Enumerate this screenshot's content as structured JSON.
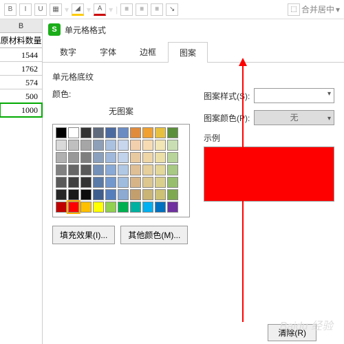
{
  "toolbar": {
    "merge_label": "合并居中"
  },
  "sheet": {
    "col": "B",
    "header": "原材料数量",
    "rows": [
      "1544",
      "1762",
      "574",
      "500",
      "1000"
    ]
  },
  "dialog": {
    "title": "单元格格式",
    "tabs": {
      "num": "数字",
      "font": "字体",
      "border": "边框",
      "pattern": "图案"
    },
    "shading": "单元格底纹",
    "color_label": "颜色:",
    "no_pattern": "无图案",
    "pattern_style": "图案样式(S):",
    "pattern_color": "图案颜色(P):",
    "none": "无",
    "sample": "示例",
    "fill_effects": "填充效果(I)...",
    "other_colors": "其他颜色(M)...",
    "clear": "清除(R)"
  },
  "palette": {
    "row1": [
      "#000000",
      "#ffffff",
      "#333333",
      "#5f6a7d",
      "#4b6aa0",
      "#6b8bc3",
      "#e08b3c",
      "#f0a030",
      "#e8c040",
      "#5b8f3a"
    ],
    "row2": [
      "#d9d9d9",
      "#bfbfbf",
      "#a6a6a6",
      "#8ea0b8",
      "#aac1e0",
      "#c7d6ec",
      "#f2d0ad",
      "#f7dcb3",
      "#f3e6b6",
      "#c9dfb3"
    ],
    "row3": [
      "#b0b0b0",
      "#999999",
      "#7f7f7f",
      "#8aa0bd",
      "#9fb8dc",
      "#c1d3ea",
      "#e8caa0",
      "#eed6a6",
      "#ecdfa8",
      "#b8d49a"
    ],
    "row4": [
      "#808080",
      "#666666",
      "#595959",
      "#7290b8",
      "#89a9d6",
      "#b0c8e4",
      "#dfbf95",
      "#e6cf9a",
      "#e3d79a",
      "#a7c983"
    ],
    "row5": [
      "#595959",
      "#404040",
      "#333333",
      "#5a7ba8",
      "#7298ce",
      "#9fbcde",
      "#d6b488",
      "#ddc78e",
      "#dbcf8d",
      "#96be6c"
    ],
    "row6": [
      "#262626",
      "#1a1a1a",
      "#0d0d0d",
      "#3e5e8e",
      "#557fbc",
      "#8caad2",
      "#c49f6e",
      "#cbb576",
      "#cdc176",
      "#7fa951"
    ],
    "row7": [
      "#c00000",
      "#ff0000",
      "#ffc000",
      "#ffff00",
      "#92d050",
      "#00b050",
      "#00b0a0",
      "#00b0f0",
      "#0070c0",
      "#7030a0"
    ]
  },
  "watermark": "Baidu 经验"
}
